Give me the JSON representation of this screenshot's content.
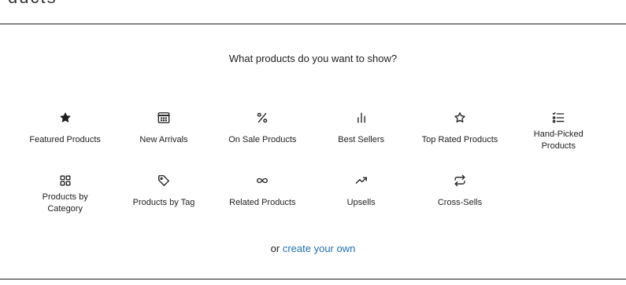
{
  "heading_remnant": "ducts",
  "question": "What products do you want to show?",
  "options": [
    {
      "label": "Featured Products",
      "icon": "star-filled-icon"
    },
    {
      "label": "New Arrivals",
      "icon": "calendar-icon"
    },
    {
      "label": "On Sale Products",
      "icon": "percent-icon"
    },
    {
      "label": "Best Sellers",
      "icon": "bar-chart-icon"
    },
    {
      "label": "Top Rated Products",
      "icon": "star-outline-icon"
    },
    {
      "label": "Hand-Picked Products",
      "icon": "checklist-icon"
    },
    {
      "label": "Products by Category",
      "icon": "category-grid-icon"
    },
    {
      "label": "Products by Tag",
      "icon": "tag-icon"
    },
    {
      "label": "Related Products",
      "icon": "infinity-link-icon"
    },
    {
      "label": "Upsells",
      "icon": "trending-up-icon"
    },
    {
      "label": "Cross-Sells",
      "icon": "repeat-arrows-icon"
    }
  ],
  "footer": {
    "prefix": "or",
    "link_label": "create your own"
  },
  "colors": {
    "link": "#2271b1",
    "text": "#1e1e1e"
  }
}
